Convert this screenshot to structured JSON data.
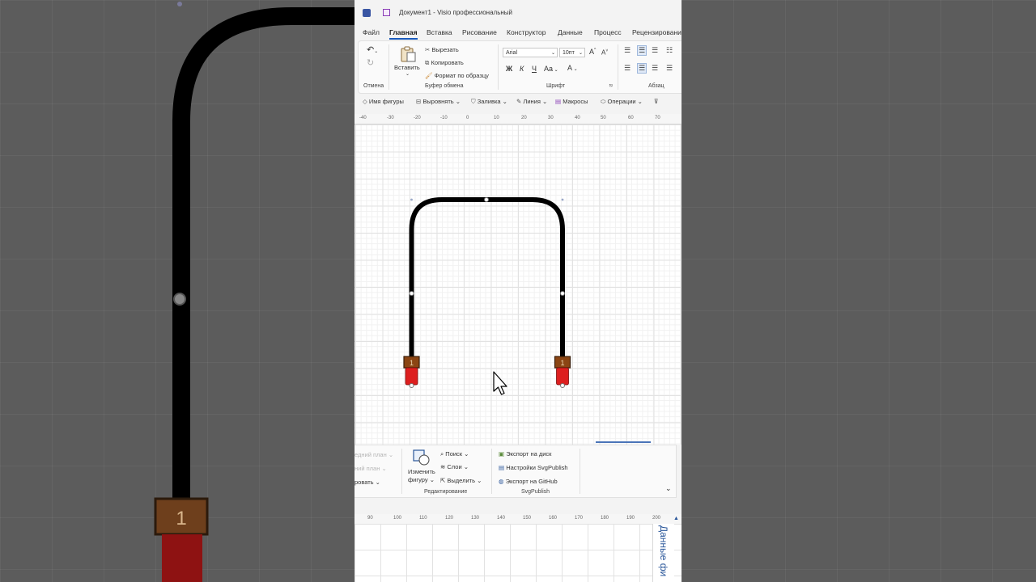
{
  "title": {
    "document": "Документ1",
    "separator": "-",
    "app": "Visio профессиональный"
  },
  "tabs": [
    "Файл",
    "Главная",
    "Вставка",
    "Рисование",
    "Конструктор",
    "Данные",
    "Процесс",
    "Рецензирование"
  ],
  "active_tab": "Главная",
  "ribbon": {
    "undo_group": {
      "label": "Отмена"
    },
    "clipboard": {
      "paste": "Вставить",
      "cut": "Вырезать",
      "copy": "Копировать",
      "format_painter": "Формат по образцу",
      "label": "Буфер обмена"
    },
    "font": {
      "font_name": "Arial",
      "font_size": "10пт",
      "grow": "A",
      "shrink": "A",
      "bold": "Ж",
      "italic": "К",
      "underline": "Ч",
      "case": "Aa",
      "color": "A",
      "label": "Шрифт"
    },
    "paragraph": {
      "label": "Абзац"
    }
  },
  "quickbar": {
    "shape_name": "Имя фигуры",
    "align": "Выровнять",
    "fill": "Заливка",
    "line": "Линия",
    "macros": "Макросы",
    "operations": "Операции"
  },
  "ruler_top": [
    "-40",
    "-30",
    "-20",
    "-10",
    "0",
    "10",
    "20",
    "30",
    "40",
    "50",
    "60",
    "70"
  ],
  "ruler_bottom": [
    "90",
    "100",
    "110",
    "120",
    "130",
    "140",
    "150",
    "160",
    "170",
    "180",
    "190",
    "200"
  ],
  "connector_labels": [
    "1",
    "1"
  ],
  "ribbon2": {
    "arrange_faded_1": "едний план",
    "arrange_faded_2": "ний план",
    "arrange_partial": "ровать",
    "change_shape_1": "Изменить",
    "change_shape_2": "фигуру",
    "find": "Поиск",
    "layers": "Слои",
    "select": "Выделить",
    "editing_label": "Редактирование",
    "export_disk": "Экспорт на диск",
    "svg_settings": "Настройки SvgPublish",
    "export_github": "Экспорт на GitHub",
    "svgpublish_label": "SvgPublish"
  },
  "side_panel": {
    "label": "Данные фи"
  },
  "side_bg": {
    "connector_label": "1"
  },
  "colors": {
    "accent": "#185abd",
    "connector_body": "#dd1f1f",
    "connector_cap": "#8b4513",
    "pipe": "#000000"
  }
}
